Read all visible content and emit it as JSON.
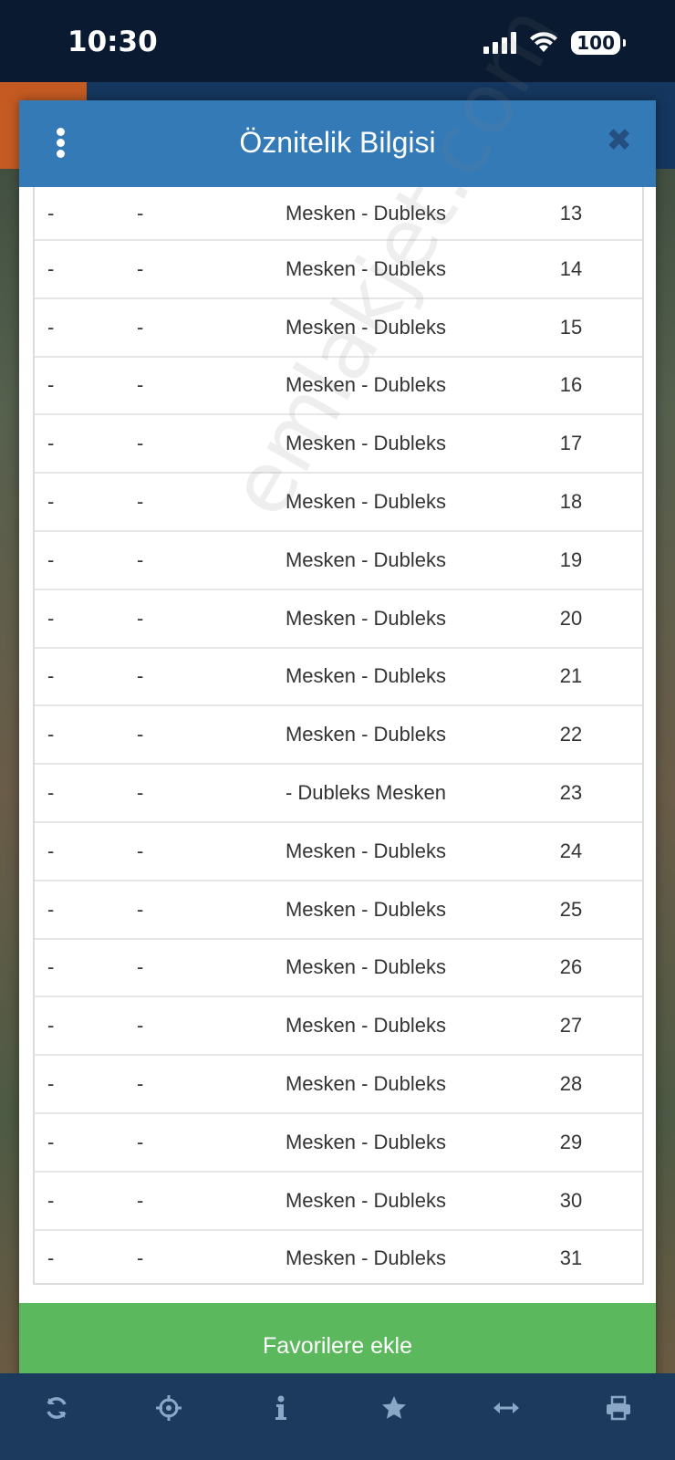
{
  "status_bar": {
    "time": "10:30",
    "battery": "100"
  },
  "modal": {
    "title": "Öznitelik Bilgisi",
    "close_symbol": "✖",
    "rows": [
      {
        "a": "-",
        "b": "-",
        "type": "Mesken - Dubleks",
        "no": "13"
      },
      {
        "a": "-",
        "b": "-",
        "type": "Mesken - Dubleks",
        "no": "14"
      },
      {
        "a": "-",
        "b": "-",
        "type": "Mesken - Dubleks",
        "no": "15"
      },
      {
        "a": "-",
        "b": "-",
        "type": "Mesken - Dubleks",
        "no": "16"
      },
      {
        "a": "-",
        "b": "-",
        "type": "Mesken - Dubleks",
        "no": "17"
      },
      {
        "a": "-",
        "b": "-",
        "type": "Mesken - Dubleks",
        "no": "18"
      },
      {
        "a": "-",
        "b": "-",
        "type": "Mesken - Dubleks",
        "no": "19"
      },
      {
        "a": "-",
        "b": "-",
        "type": "Mesken - Dubleks",
        "no": "20"
      },
      {
        "a": "-",
        "b": "-",
        "type": "Mesken - Dubleks",
        "no": "21"
      },
      {
        "a": "-",
        "b": "-",
        "type": "Mesken - Dubleks",
        "no": "22"
      },
      {
        "a": "-",
        "b": "-",
        "type": "- Dubleks Mesken",
        "no": "23"
      },
      {
        "a": "-",
        "b": "-",
        "type": "Mesken - Dubleks",
        "no": "24"
      },
      {
        "a": "-",
        "b": "-",
        "type": "Mesken - Dubleks",
        "no": "25"
      },
      {
        "a": "-",
        "b": "-",
        "type": "Mesken - Dubleks",
        "no": "26"
      },
      {
        "a": "-",
        "b": "-",
        "type": "Mesken - Dubleks",
        "no": "27"
      },
      {
        "a": "-",
        "b": "-",
        "type": "Mesken - Dubleks",
        "no": "28"
      },
      {
        "a": "-",
        "b": "-",
        "type": "Mesken - Dubleks",
        "no": "29"
      },
      {
        "a": "-",
        "b": "-",
        "type": "Mesken - Dubleks",
        "no": "30"
      },
      {
        "a": "-",
        "b": "-",
        "type": "Mesken - Dubleks",
        "no": "31"
      }
    ],
    "favorite_button": "Favorilere ekle"
  },
  "watermark": "emlakjet.com",
  "toolbar": {
    "icons": [
      "refresh-icon",
      "crosshair-icon",
      "info-icon",
      "star-icon",
      "arrows-horizontal-icon",
      "print-icon"
    ]
  },
  "colors": {
    "header": "#337ab7",
    "button": "#5cb85c",
    "toolbar": "#1c3a5e"
  }
}
